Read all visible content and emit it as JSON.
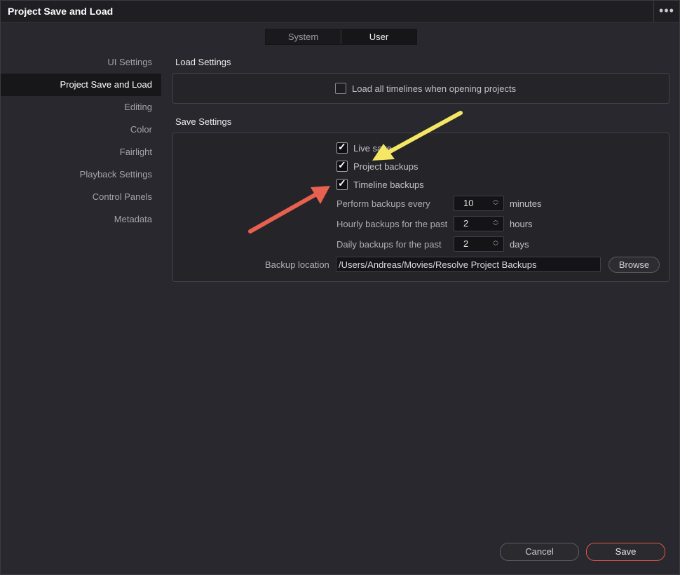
{
  "window": {
    "title": "Project Save and Load",
    "menu_icon": "more-dots-icon"
  },
  "tabs": [
    {
      "label": "System",
      "active": false
    },
    {
      "label": "User",
      "active": true
    }
  ],
  "sidebar": {
    "items": [
      {
        "label": "UI Settings",
        "active": false
      },
      {
        "label": "Project Save and Load",
        "active": true
      },
      {
        "label": "Editing",
        "active": false
      },
      {
        "label": "Color",
        "active": false
      },
      {
        "label": "Fairlight",
        "active": false
      },
      {
        "label": "Playback Settings",
        "active": false
      },
      {
        "label": "Control Panels",
        "active": false
      },
      {
        "label": "Metadata",
        "active": false
      }
    ]
  },
  "load_settings": {
    "title": "Load Settings",
    "load_all_timelines": {
      "label": "Load all timelines when opening projects",
      "checked": false
    }
  },
  "save_settings": {
    "title": "Save Settings",
    "live_save": {
      "label": "Live save",
      "checked": true
    },
    "project_backups": {
      "label": "Project backups",
      "checked": true
    },
    "timeline_backups": {
      "label": "Timeline backups",
      "checked": true
    },
    "perform_backups": {
      "label": "Perform backups every",
      "value": "10",
      "unit": "minutes"
    },
    "hourly_backups": {
      "label": "Hourly backups for the past",
      "value": "2",
      "unit": "hours"
    },
    "daily_backups": {
      "label": "Daily backups for the past",
      "value": "2",
      "unit": "days"
    },
    "backup_location": {
      "label": "Backup location",
      "value": "/Users/Andreas/Movies/Resolve Project Backups",
      "browse_label": "Browse"
    }
  },
  "footer": {
    "cancel_label": "Cancel",
    "save_label": "Save"
  },
  "annotations": {
    "yellow_arrow_color": "#f5e663",
    "red_arrow_color": "#e8604f"
  },
  "colors": {
    "save_accent": "#e0564c",
    "background": "#28282e"
  }
}
